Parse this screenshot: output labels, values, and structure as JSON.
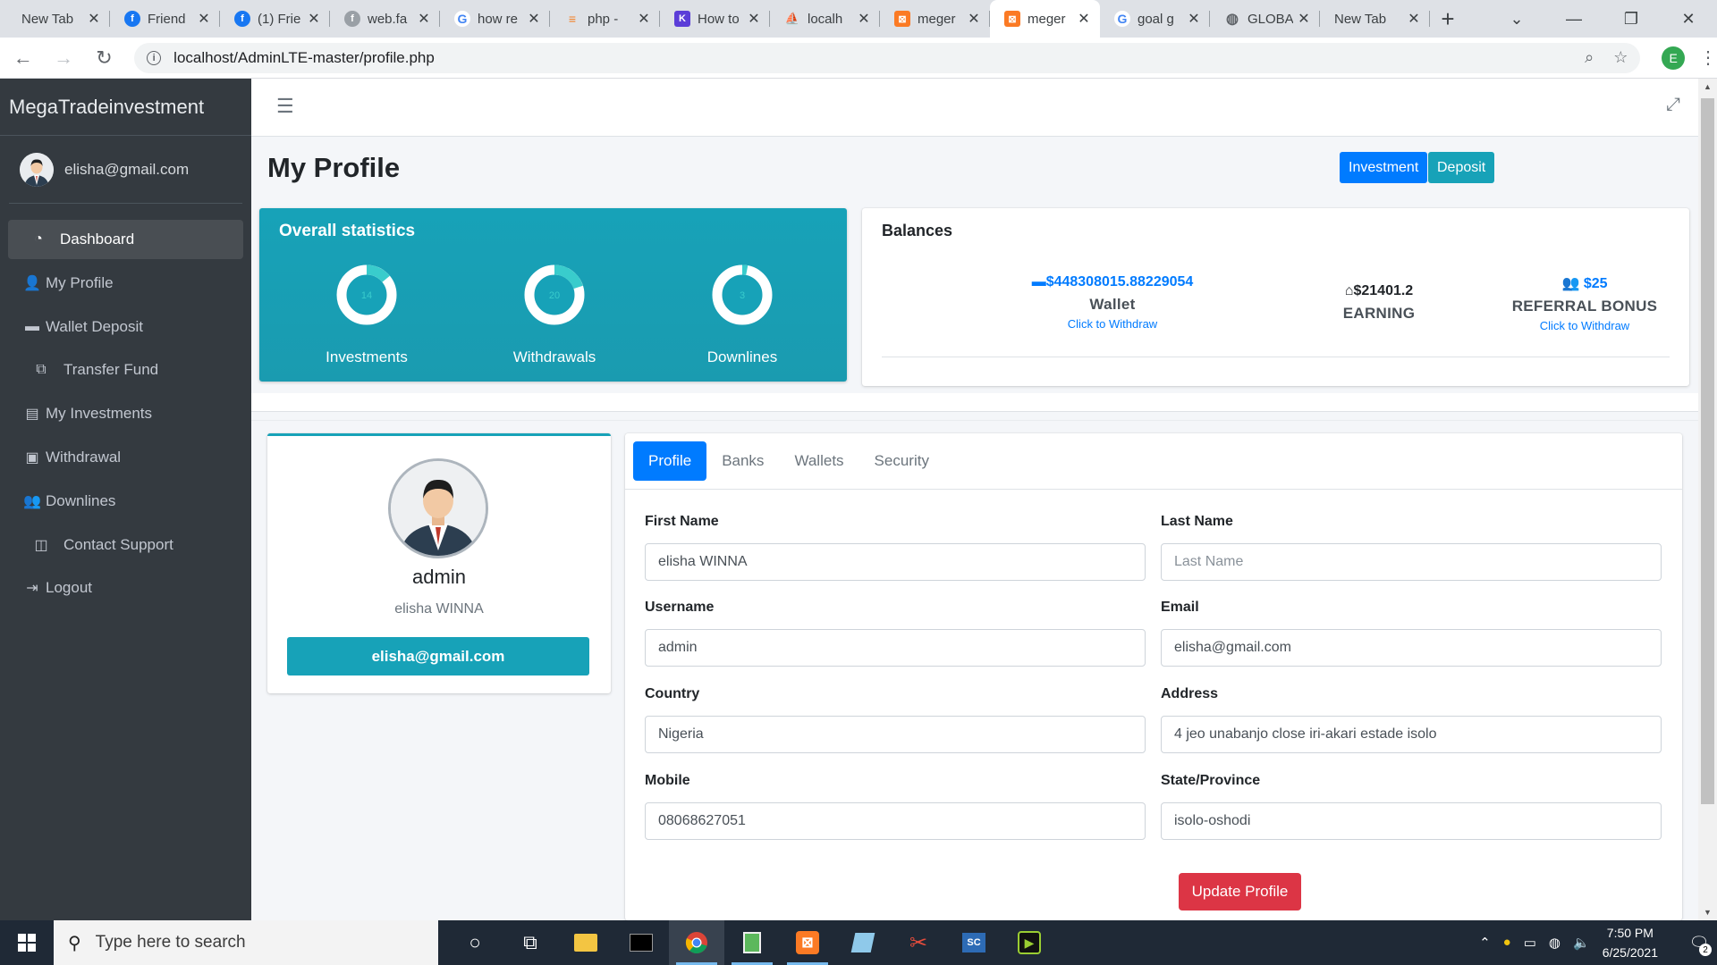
{
  "browser": {
    "tabs": [
      {
        "title": "New Tab",
        "icon": "none",
        "active": false
      },
      {
        "title": "Friend",
        "icon": "facebook-icon",
        "active": false
      },
      {
        "title": "(1) Frie",
        "icon": "facebook-icon",
        "active": false
      },
      {
        "title": "web.fa",
        "icon": "facebook-gray-icon",
        "active": false
      },
      {
        "title": "how re",
        "icon": "google-icon",
        "active": false
      },
      {
        "title": "php - ",
        "icon": "stackoverflow-icon",
        "active": false
      },
      {
        "title": "How to",
        "icon": "k-icon",
        "active": false
      },
      {
        "title": "localh",
        "icon": "phpmyadmin-icon",
        "active": false
      },
      {
        "title": "meger",
        "icon": "xampp-icon",
        "active": false
      },
      {
        "title": "meger",
        "icon": "xampp-icon",
        "active": true
      },
      {
        "title": "goal g",
        "icon": "google-icon",
        "active": false
      },
      {
        "title": "GLOBA",
        "icon": "globe-icon",
        "active": false
      },
      {
        "title": "New Tab",
        "icon": "none",
        "active": false
      }
    ],
    "url": "localhost/AdminLTE-master/profile.php",
    "profile_initial": "E"
  },
  "sidebar": {
    "brand": "MegaTradeinvestment",
    "user_email": "elisha@gmail.com",
    "items": [
      {
        "label": "Dashboard",
        "icon": "tachometer-icon"
      },
      {
        "label": "My Profile",
        "icon": "user-icon"
      },
      {
        "label": "Wallet Deposit",
        "icon": "wallet-icon"
      },
      {
        "label": "Transfer Fund",
        "icon": "copy-icon"
      },
      {
        "label": "My Investments",
        "icon": "briefcase-icon"
      },
      {
        "label": "Withdrawal",
        "icon": "money-icon"
      },
      {
        "label": "Downlines",
        "icon": "users-icon"
      },
      {
        "label": "Contact Support",
        "icon": "columns-icon"
      },
      {
        "label": "Logout",
        "icon": "sign-out-icon"
      }
    ]
  },
  "header": {
    "title": "My Profile",
    "investment_btn": "Investment",
    "deposit_btn": "Deposit"
  },
  "stats": {
    "title": "Overall statistics",
    "items": [
      {
        "label": "Investments",
        "value": "14",
        "fraction": 0.14
      },
      {
        "label": "Withdrawals",
        "value": "20",
        "fraction": 0.2
      },
      {
        "label": "Downlines",
        "value": "3",
        "fraction": 0.03
      }
    ],
    "accent": "#17a2b8",
    "knob_color": "#39cccc"
  },
  "balances": {
    "title": "Balances",
    "wallet": {
      "amount": "$448308015.88229054",
      "label": "Wallet",
      "link": "Click to Withdraw"
    },
    "earning": {
      "amount": "$21401.2",
      "label": "EARNING"
    },
    "referral": {
      "amount": "$25",
      "label": "REFERRAL BONUS",
      "link": "Click to Withdraw"
    }
  },
  "profile": {
    "username": "admin",
    "fullname": "elisha WINNA",
    "email": "elisha@gmail.com"
  },
  "form": {
    "tabs": [
      "Profile",
      "Banks",
      "Wallets",
      "Security"
    ],
    "first_name_label": "First Name",
    "first_name_value": "elisha WINNA",
    "last_name_label": "Last Name",
    "last_name_placeholder": "Last Name",
    "username_label": "Username",
    "username_value": "admin",
    "email_label": "Email",
    "email_value": "elisha@gmail.com",
    "country_label": "Country",
    "country_value": "Nigeria",
    "address_label": "Address",
    "address_value": "4 jeo unabanjo close iri-akari estade isolo",
    "mobile_label": "Mobile",
    "mobile_value": "08068627051",
    "state_label": "State/Province",
    "state_value": "isolo-oshodi",
    "submit_label": "Update Profile"
  },
  "taskbar": {
    "search_placeholder": "Type here to search",
    "time": "7:50 PM",
    "date": "6/25/2021",
    "notification_count": "2"
  }
}
